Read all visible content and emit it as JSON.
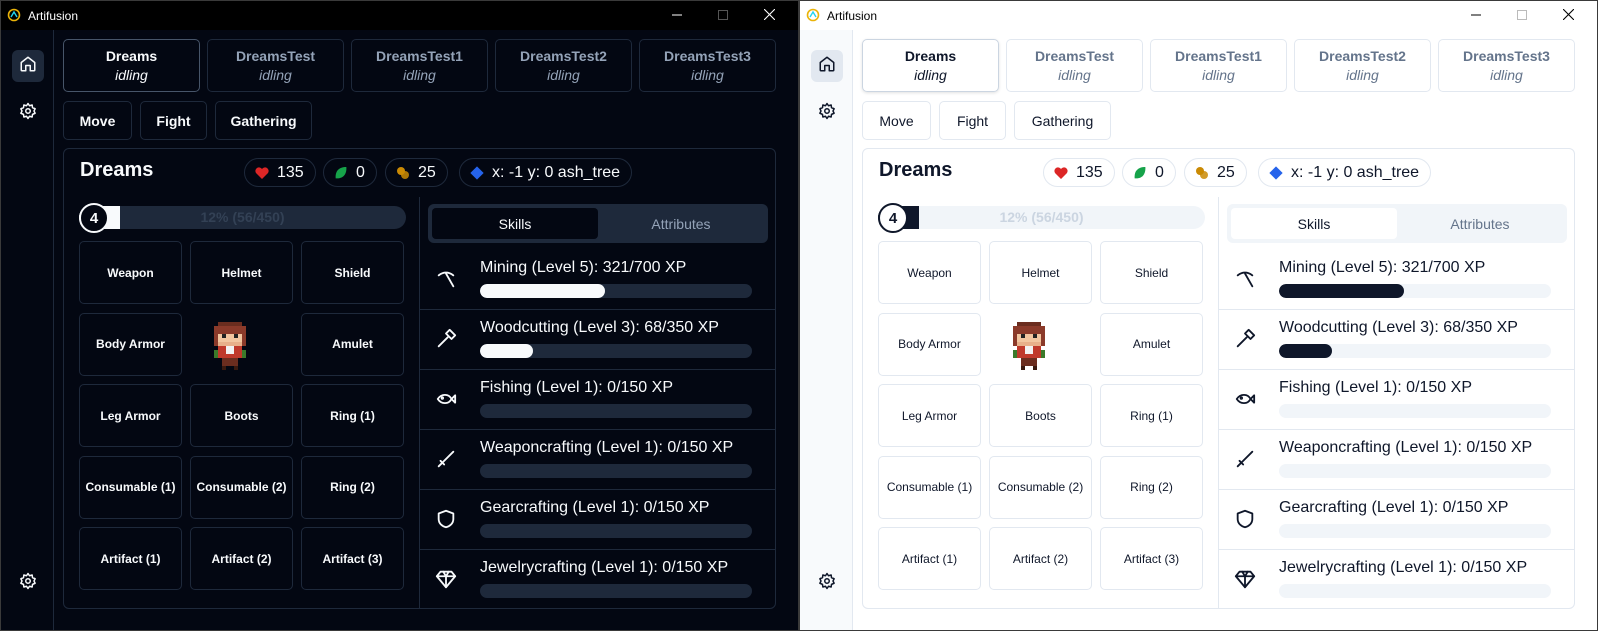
{
  "app": {
    "title": "Artifusion"
  },
  "characters": [
    {
      "name": "Dreams",
      "status": "idling"
    },
    {
      "name": "DreamsTest",
      "status": "idling"
    },
    {
      "name": "DreamsTest1",
      "status": "idling"
    },
    {
      "name": "DreamsTest2",
      "status": "idling"
    },
    {
      "name": "DreamsTest3",
      "status": "idling"
    }
  ],
  "actions": [
    "Move",
    "Fight",
    "Gathering"
  ],
  "character": {
    "name": "Dreams",
    "hp": "135",
    "gold_leaf": "0",
    "gold": "25",
    "position": "x: -1 y: 0 ash_tree",
    "level": "4",
    "level_progress_text": "12% (56/450)",
    "level_progress": 0.124
  },
  "equipment_slots": [
    "Weapon",
    "Helmet",
    "Shield",
    "Body Armor",
    "Amulet",
    "Leg Armor",
    "Boots",
    "Ring (1)",
    "Consumable (1)",
    "Consumable (2)",
    "Ring (2)",
    "Artifact (1)",
    "Artifact (2)",
    "Artifact (3)"
  ],
  "panel_tabs": [
    "Skills",
    "Attributes"
  ],
  "skills": [
    {
      "label": "Mining (Level 5): 321/700 XP",
      "progress": 0.4586,
      "icon": "pickaxe-icon"
    },
    {
      "label": "Woodcutting (Level 3): 68/350 XP",
      "progress": 0.1943,
      "icon": "axe-icon"
    },
    {
      "label": "Fishing (Level 1): 0/150 XP",
      "progress": 0,
      "icon": "fish-icon"
    },
    {
      "label": "Weaponcrafting (Level 1): 0/150 XP",
      "progress": 0,
      "icon": "sword-icon"
    },
    {
      "label": "Gearcrafting (Level 1): 0/150 XP",
      "progress": 0,
      "icon": "shield-icon"
    },
    {
      "label": "Jewelrycrafting (Level 1): 0/150 XP",
      "progress": 0,
      "icon": "gem-icon"
    }
  ],
  "themes": {
    "dark": {
      "bg": "#030712",
      "text": "#f8fafc",
      "border": "#1e293b",
      "muted": "#94a3b8",
      "bar_track": "#1e293b",
      "bar_fill": "#f8fafc",
      "active_tab": "#030712"
    },
    "light": {
      "bg": "#ffffff",
      "text": "#0f172a",
      "border": "#e2e8f0",
      "muted": "#64748b",
      "bar_track": "#f1f5f9",
      "bar_fill": "#0f172a",
      "active_tab": "#ffffff"
    }
  },
  "accent_colors": {
    "heart": "#dc2626",
    "leaf": "#16a34a",
    "gold": "#ca8a04",
    "gem": "#2563eb"
  }
}
